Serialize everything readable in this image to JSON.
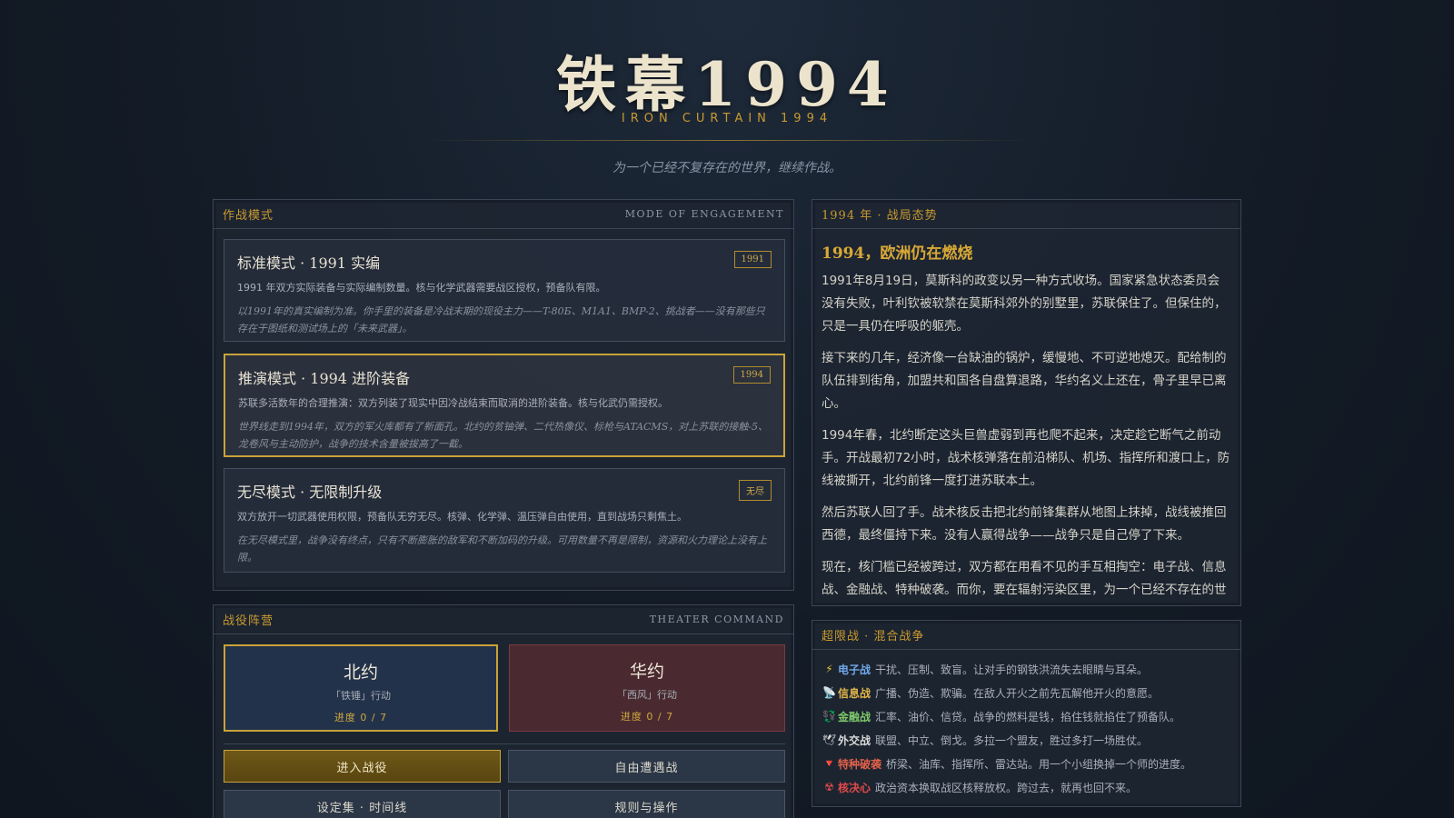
{
  "header": {
    "title": "铁幕1994",
    "subtitle_en": "IRON CURTAIN 1994",
    "tagline": "为一个已经不复存在的世界，继续作战。"
  },
  "mode_panel": {
    "title_cn": "作战模式",
    "title_en": "MODE OF ENGAGEMENT",
    "modes": [
      {
        "title": "标准模式 · 1991 实编",
        "tag": "1991",
        "desc": "1991 年双方实际装备与实际编制数量。核与化学武器需要战区授权，预备队有限。",
        "flavor": "以1991年的真实编制为准。你手里的装备是冷战末期的现役主力——T-80Б、M1A1、BMP-2、挑战者——没有那些只存在于图纸和测试场上的「未来武器」。",
        "selected": false
      },
      {
        "title": "推演模式 · 1994 进阶装备",
        "tag": "1994",
        "desc": "苏联多活数年的合理推演：双方列装了现实中因冷战结束而取消的进阶装备。核与化武仍需授权。",
        "flavor": "世界线走到1994年，双方的军火库都有了新面孔。北约的贫铀弹、二代热像仪、标枪与ATACMS，对上苏联的接触-5、龙卷风与主动防护，战争的技术含量被拔高了一截。",
        "selected": true
      },
      {
        "title": "无尽模式 · 无限制升级",
        "tag": "无尽",
        "desc": "双方放开一切武器使用权限，预备队无穷无尽。核弹、化学弹、温压弹自由使用，直到战场只剩焦土。",
        "flavor": "在无尽模式里，战争没有终点，只有不断膨胀的敌军和不断加码的升级。可用数量不再是限制，资源和火力理论上没有上限。",
        "selected": false
      }
    ]
  },
  "theater_panel": {
    "title_cn": "战役阵营",
    "title_en": "THEATER COMMAND",
    "factions": [
      {
        "name": "北约",
        "operation": "「铁锤」行动",
        "progress": "进度 0 / 7"
      },
      {
        "name": "华约",
        "operation": "「西风」行动",
        "progress": "进度 0 / 7"
      }
    ],
    "buttons": {
      "enter_campaign": "进入战役",
      "free_battle": "自由遭遇战",
      "settings": "设定集 · 时间线",
      "rules": "规则与操作"
    }
  },
  "situation_panel": {
    "title_cn": "1994 年 · 战局态势",
    "heading": "1994，欧洲仍在燃烧",
    "paragraphs": [
      "1991年8月19日，莫斯科的政变以另一种方式收场。国家紧急状态委员会没有失败，叶利钦被软禁在莫斯科郊外的别墅里，苏联保住了。但保住的，只是一具仍在呼吸的躯壳。",
      "接下来的几年，经济像一台缺油的锅炉，缓慢地、不可逆地熄灭。配给制的队伍排到街角，加盟共和国各自盘算退路，华约名义上还在，骨子里早已离心。",
      "1994年春，北约断定这头巨兽虚弱到再也爬不起来，决定趁它断气之前动手。开战最初72小时，战术核弹落在前沿梯队、机场、指挥所和渡口上，防线被撕开，北约前锋一度打进苏联本土。",
      "然后苏联人回了手。战术核反击把北约前锋集群从地图上抹掉，战线被推回西德，最终僵持下来。没有人赢得战争——战争只是自己停了下来。",
      "现在，核门槛已经被跨过，双方都在用看不见的手互相掏空：电子战、信息战、金融战、特种破袭。而你，要在辐射污染区里，为一个已经不存在的世界继续打下去。"
    ]
  },
  "hybrid_panel": {
    "title_cn": "超限战 · 混合战争",
    "items": [
      {
        "icon": "lightning-icon",
        "glyph": "⚡",
        "name": "电子战",
        "color": "#6fa8e8",
        "desc": "干扰、压制、致盲。让对手的钢铁洪流失去眼睛与耳朵。"
      },
      {
        "icon": "broadcast-icon",
        "glyph": "📡",
        "name": "信息战",
        "color": "#e0b44a",
        "desc": "广播、伪造、欺骗。在敌人开火之前先瓦解他开火的意愿。"
      },
      {
        "icon": "money-icon",
        "glyph": "💱",
        "name": "金融战",
        "color": "#7ec86a",
        "desc": "汇率、油价、信贷。战争的燃料是钱，掐住钱就掐住了预备队。"
      },
      {
        "icon": "dove-icon",
        "glyph": "🕊",
        "name": "外交战",
        "color": "#d8d8d8",
        "desc": "联盟、中立、倒戈。多拉一个盟友，胜过多打一场胜仗。"
      },
      {
        "icon": "drop-down-triangle-icon",
        "glyph": "🔻",
        "name": "特种破袭",
        "color": "#e0604a",
        "desc": "桥梁、油库、指挥所、雷达站。用一个小组换掉一个师的进度。"
      },
      {
        "icon": "radiation-icon",
        "glyph": "☢",
        "name": "核决心",
        "color": "#e04a4a",
        "desc": "政治资本换取战区核释放权。跨过去，就再也回不来。"
      }
    ]
  }
}
